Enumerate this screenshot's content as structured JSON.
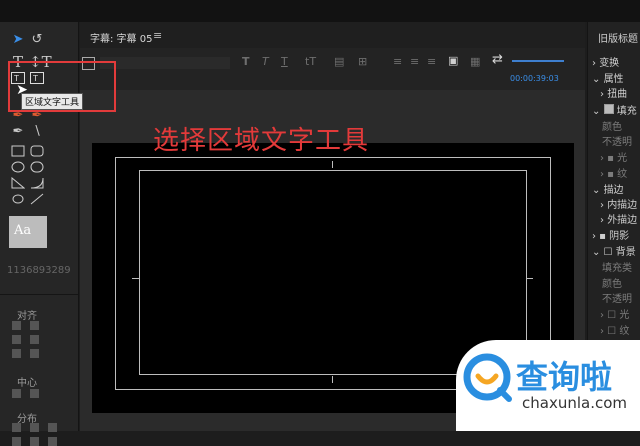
{
  "header": {
    "tab_title": "字幕: 字幕 05",
    "menu_icon": "≡",
    "timecode": "00:00:39:03"
  },
  "tools": {
    "tooltip": "区域文字工具",
    "style_sample": "Aa",
    "style_id": "1136893289",
    "section_align": "对齐",
    "section_center": "中心",
    "section_distribute": "分布"
  },
  "annotation": {
    "text": "选择区域文字工具",
    "color": "#e33a3a",
    "box_color": "#e23b3b"
  },
  "right_panel": {
    "title": "旧版标题",
    "items": [
      "变换",
      "属性",
      "扭曲",
      "填充",
      "颜色",
      "不透明",
      "光",
      "纹",
      "描边",
      "内描边",
      "外描边",
      "阴影",
      "背景",
      "填充类",
      "颜色",
      "不透明",
      "光",
      "纹"
    ]
  },
  "watermark": {
    "name": "查询啦",
    "url": "chaxunla.com",
    "color": "#2a8ee0"
  }
}
